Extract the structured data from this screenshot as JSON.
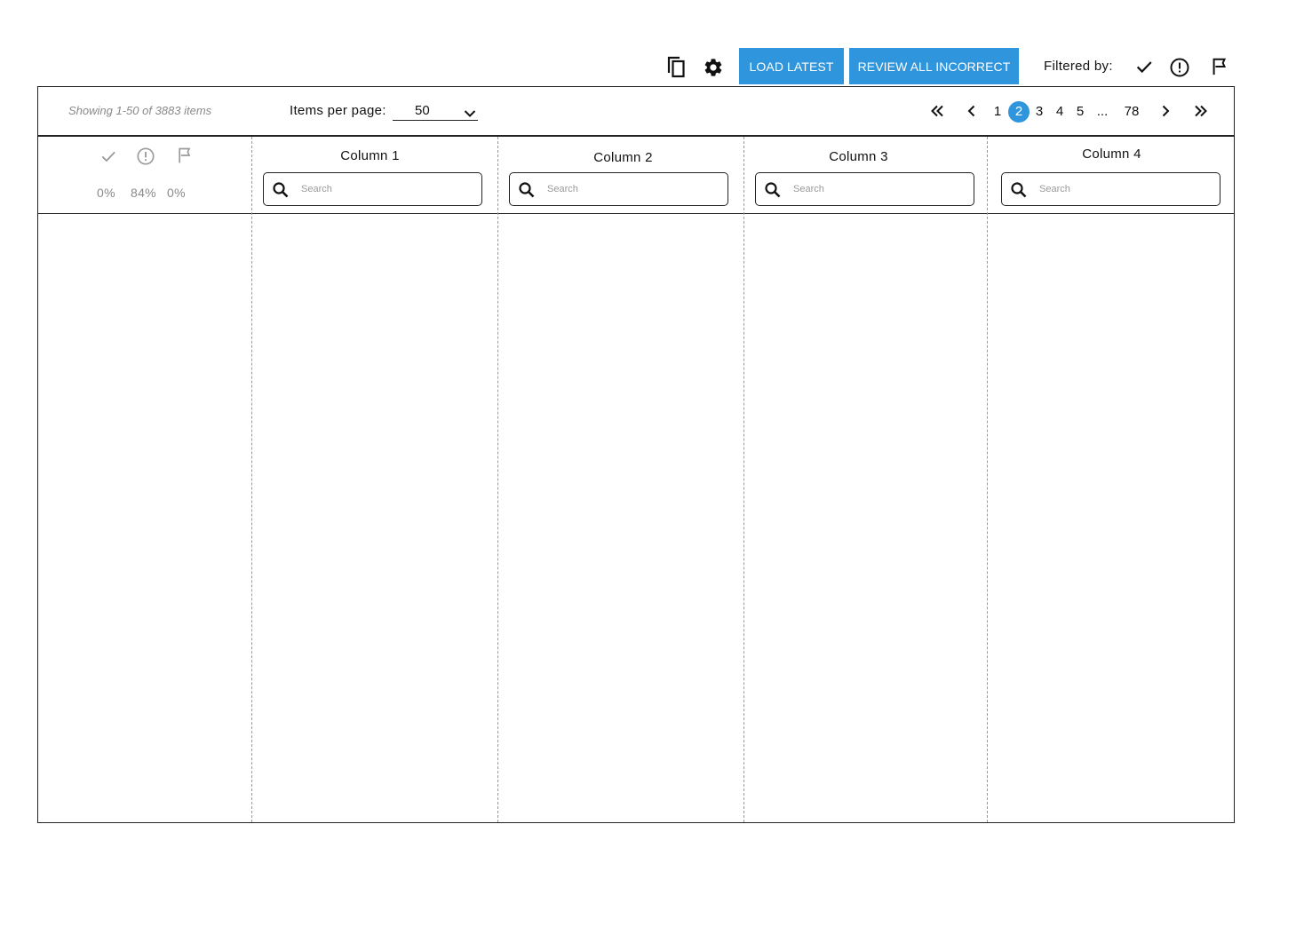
{
  "toolbar": {
    "copy_icon": "copy-icon",
    "settings_icon": "gear-icon",
    "load_latest_label": "LOAD LATEST",
    "review_all_label": "REVIEW ALL INCORRECT",
    "filter_label": "Filtered by:",
    "filter_icons": [
      "check-icon",
      "alert-circle-icon",
      "flag-icon"
    ],
    "accent_color": "#2f95dc"
  },
  "pager": {
    "showing_text": "Showing 1-50 of 3883 items",
    "items_per_page_label": "Items per page:",
    "items_per_page_value": "50",
    "pages": [
      "1",
      "2",
      "3",
      "4",
      "5",
      "...",
      "78"
    ],
    "current_page": "2"
  },
  "stats": {
    "icons": [
      "check-icon",
      "alert-circle-icon",
      "flag-icon"
    ],
    "correct": "0%",
    "incorrect": "84%",
    "flagged": "0%"
  },
  "columns": [
    {
      "title": "Column 1",
      "search_placeholder": "Search"
    },
    {
      "title": "Column 2",
      "search_placeholder": "Search"
    },
    {
      "title": "Column 3",
      "search_placeholder": "Search"
    },
    {
      "title": "Column 4",
      "search_placeholder": "Search"
    }
  ]
}
